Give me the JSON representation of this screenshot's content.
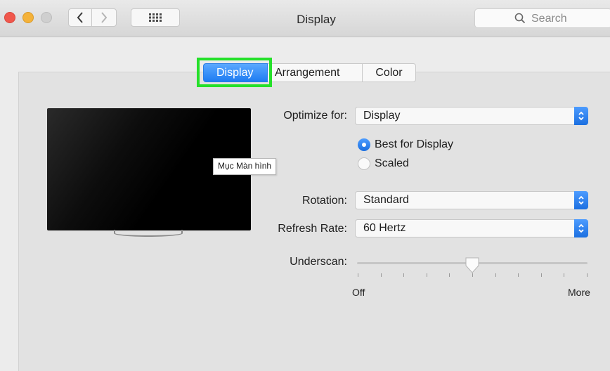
{
  "window": {
    "title": "Display",
    "search_placeholder": "Search"
  },
  "tabs": [
    {
      "label": "Display",
      "active": true
    },
    {
      "label": "Arrangement",
      "active": false
    },
    {
      "label": "Color",
      "active": false
    }
  ],
  "tooltip": "Mục Màn hình",
  "optimize": {
    "label": "Optimize for:",
    "value": "Display"
  },
  "resolution": {
    "options": [
      {
        "label": "Best for Display",
        "selected": true
      },
      {
        "label": "Scaled",
        "selected": false
      }
    ]
  },
  "rotation": {
    "label": "Rotation:",
    "value": "Standard"
  },
  "refresh": {
    "label": "Refresh Rate:",
    "value": "60 Hertz"
  },
  "underscan": {
    "label": "Underscan:",
    "min_label": "Off",
    "max_label": "More",
    "tick_count": 11,
    "value_fraction": 0.5
  },
  "colors": {
    "accent": "#1e7cf2",
    "highlight_box": "#25e02a"
  },
  "icons": [
    "close-icon",
    "minimize-icon",
    "zoom-icon",
    "chevron-left-icon",
    "chevron-right-icon",
    "grid-icon",
    "search-icon",
    "popup-arrows-icon"
  ]
}
